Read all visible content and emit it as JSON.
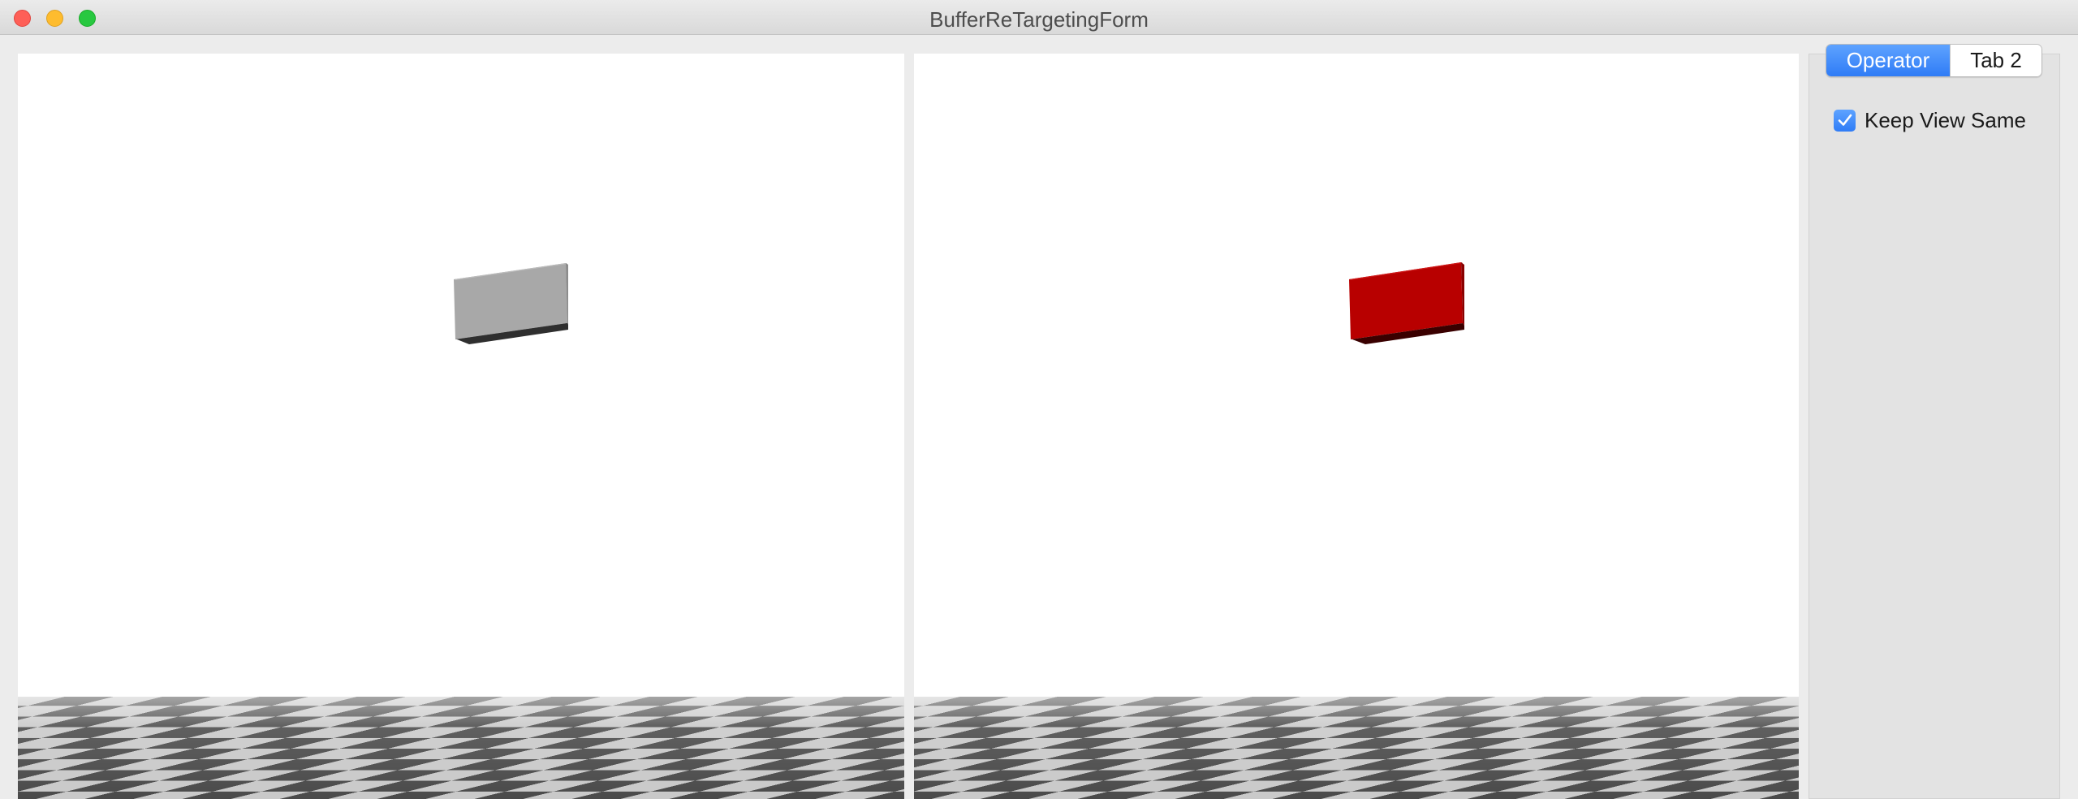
{
  "window": {
    "title": "BufferReTargetingForm"
  },
  "viewports": {
    "left": {
      "box_color": "#a8a8a8",
      "box_shade": "#2f2f2f",
      "box_top": "#bcbcbc"
    },
    "right": {
      "box_color": "#b80000",
      "box_shade": "#3a0000",
      "box_top": "#cf1a1a"
    }
  },
  "panel": {
    "tabs": [
      {
        "label": "Operator",
        "active": true
      },
      {
        "label": "Tab 2",
        "active": false
      }
    ],
    "keep_view_same": {
      "label": "Keep View Same",
      "checked": true
    }
  }
}
